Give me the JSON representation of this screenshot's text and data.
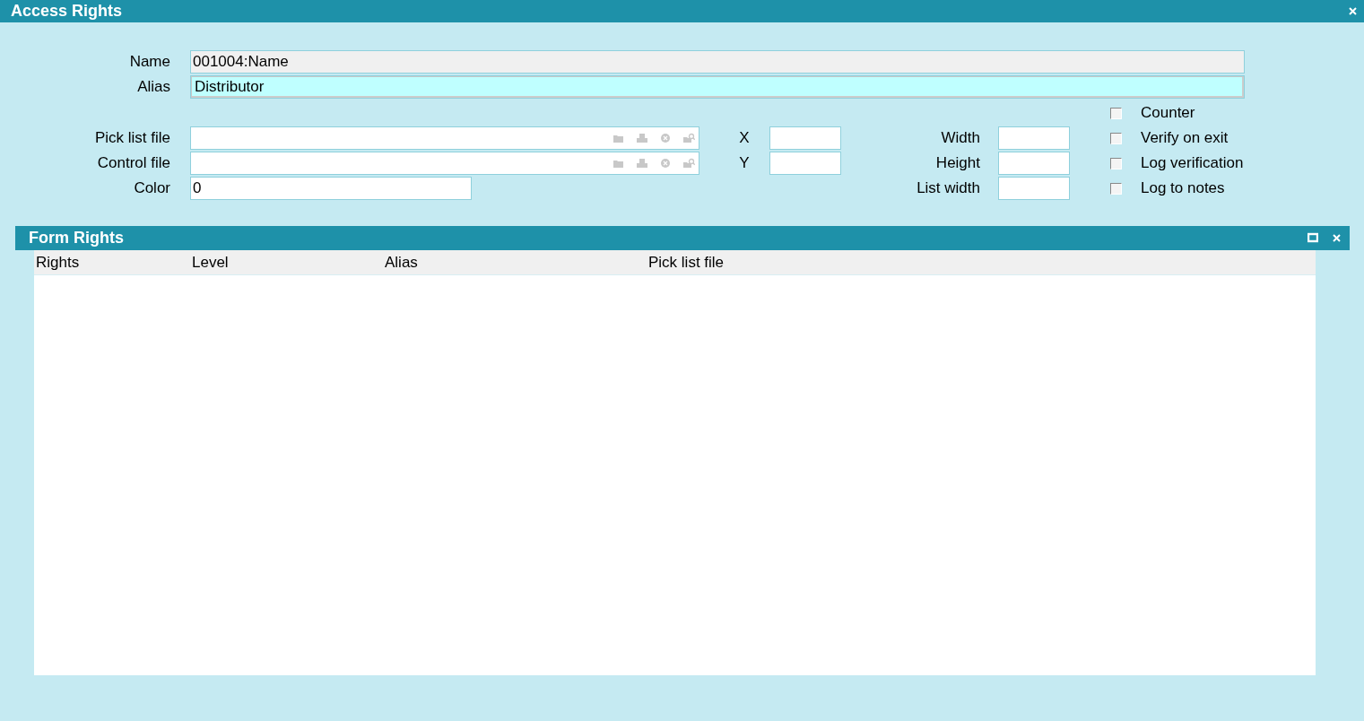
{
  "window": {
    "title": "Access Rights"
  },
  "name": {
    "label": "Name",
    "value": "001004:Name"
  },
  "alias": {
    "label": "Alias",
    "value": "Distributor"
  },
  "file_fields": [
    {
      "label": "Pick list file"
    },
    {
      "label": "Control file"
    }
  ],
  "color": {
    "label": "Color",
    "value": "0"
  },
  "position_fields": [
    {
      "label": "X"
    },
    {
      "label": "Y"
    }
  ],
  "size_fields": [
    {
      "label": "Width"
    },
    {
      "label": "Height"
    },
    {
      "label": "List width"
    }
  ],
  "checkboxes": [
    {
      "label": "Counter",
      "checked": false
    },
    {
      "label": "Verify on exit",
      "checked": false
    },
    {
      "label": "Log verification",
      "checked": false
    },
    {
      "label": "Log to notes",
      "checked": false
    }
  ],
  "form_rights": {
    "title": "Form Rights",
    "columns": [
      "Rights",
      "Level",
      "Alias",
      "Pick list file"
    ]
  }
}
